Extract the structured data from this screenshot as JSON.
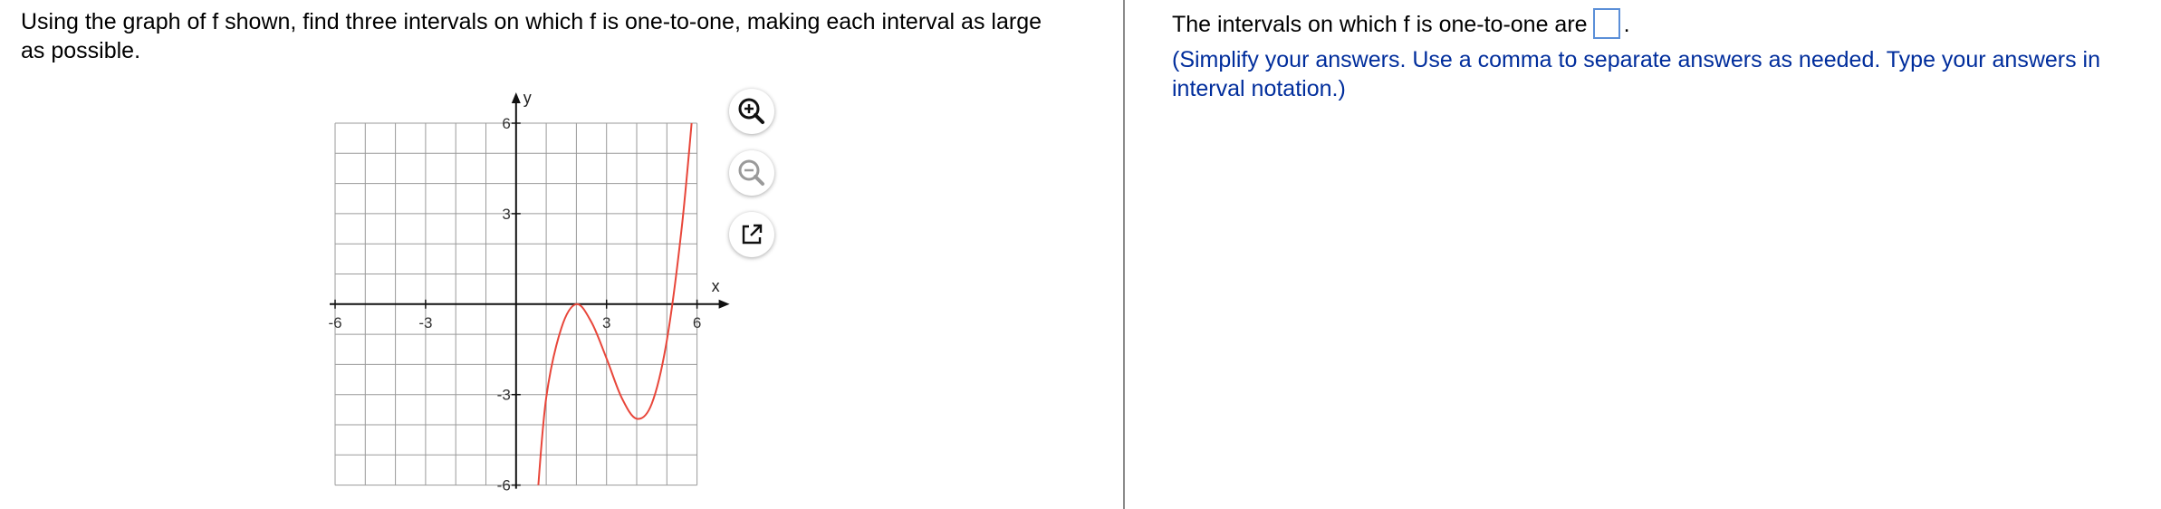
{
  "question": {
    "text": "Using the graph of f shown, find three intervals on which f is one-to-one, making each interval as large as possible."
  },
  "graph": {
    "x_axis_label": "x",
    "y_axis_label": "y",
    "xlim": [
      -6,
      6
    ],
    "ylim": [
      -6,
      6
    ],
    "grid_step": 1,
    "x_tick_labels": [
      {
        "value": -6,
        "text": "-6"
      },
      {
        "value": -3,
        "text": "-3"
      },
      {
        "value": 3,
        "text": "3"
      },
      {
        "value": 6,
        "text": "6"
      }
    ],
    "y_tick_labels": [
      {
        "value": 6,
        "text": "6"
      },
      {
        "value": 3,
        "text": "3"
      },
      {
        "value": -3,
        "text": "-3"
      },
      {
        "value": -6,
        "text": "-6"
      }
    ],
    "curve_color": "#e8463a",
    "curve_points": [
      [
        0.7,
        -6.5
      ],
      [
        1.0,
        -3.1
      ],
      [
        1.5,
        -0.8
      ],
      [
        2.0,
        0.0
      ],
      [
        2.5,
        -0.6
      ],
      [
        3.0,
        -1.8
      ],
      [
        3.5,
        -3.1
      ],
      [
        4.0,
        -3.8
      ],
      [
        4.5,
        -3.3
      ],
      [
        5.0,
        -1.2
      ],
      [
        5.5,
        2.6
      ],
      [
        5.9,
        6.9
      ]
    ]
  },
  "tools": {
    "zoom_in_icon": "zoom-in-icon",
    "zoom_out_icon": "zoom-out-icon",
    "popout_icon": "external-link-icon"
  },
  "answer": {
    "prefix": "The intervals on which f is one-to-one are",
    "suffix": ".",
    "value": ""
  },
  "instruction": {
    "text": "(Simplify your answers. Use a comma to separate answers as needed. Type your answers in interval notation.)"
  },
  "colors": {
    "instruction": "#002d9c",
    "answer_box_border": "#5b8fd8",
    "grid": "#9a9a9a",
    "axis": "#111111"
  }
}
